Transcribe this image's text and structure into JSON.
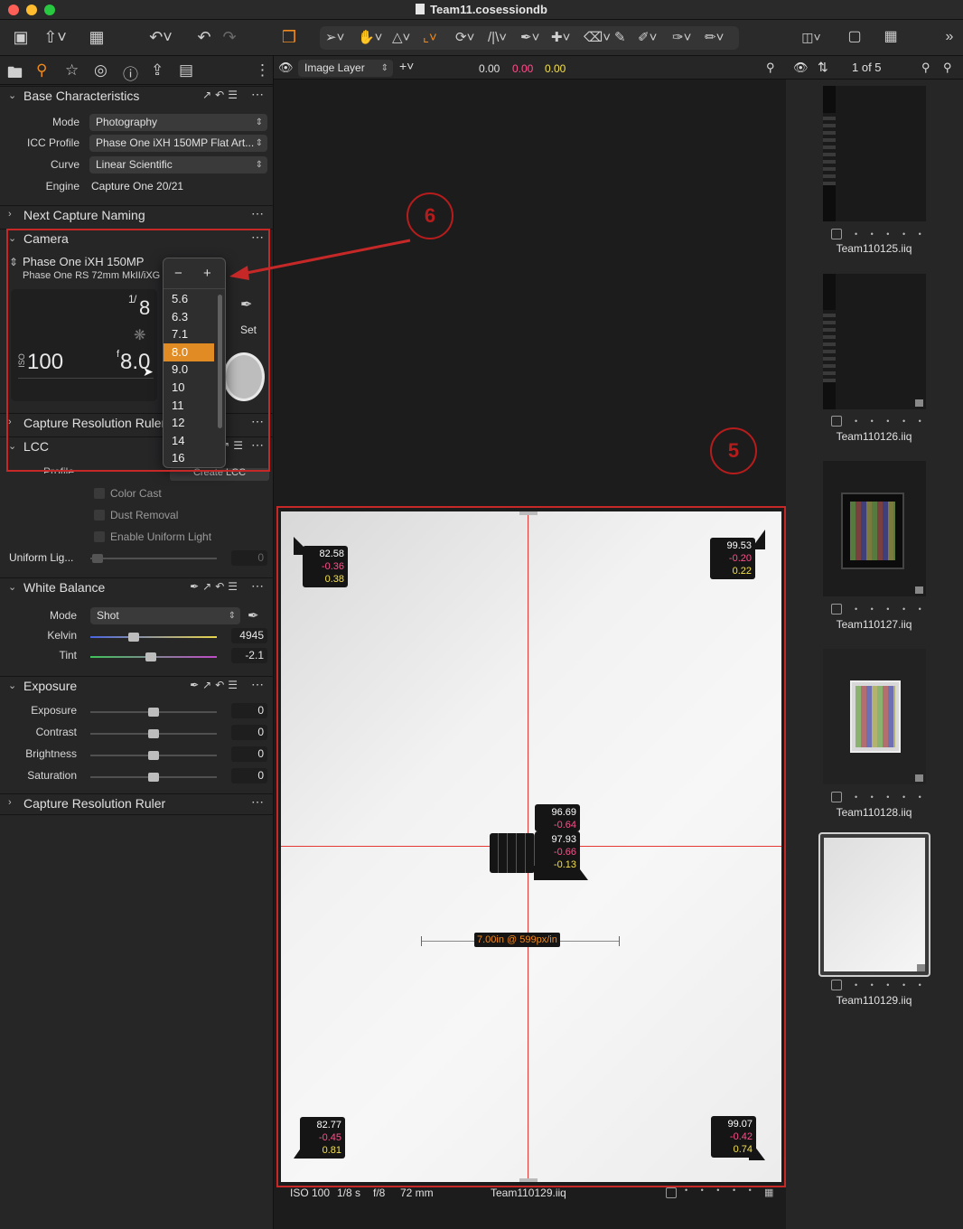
{
  "window": {
    "title": "Team11.cosessiondb"
  },
  "toolbar": {
    "icons": [
      "camera-icon",
      "export-icon",
      "edit-icon",
      "undo-history-icon",
      "undo-icon",
      "redo-icon",
      "variants-icon",
      "select-cursor-icon",
      "hand-pan-icon",
      "crop-straighten-icon",
      "crop-icon",
      "rotate-icon",
      "keystone-icon",
      "picker-icon",
      "heal-icon",
      "erase-icon",
      "brush-icon",
      "color-picker-icon",
      "annotation-icon",
      "gradient-icon"
    ],
    "right_icons": [
      "layout-icon",
      "proof-icon",
      "grid-icon",
      "more-icon"
    ]
  },
  "left_tabs": [
    "folder-icon",
    "adjust-icon",
    "star-icon",
    "color-icon",
    "info-icon",
    "export-icon",
    "list-icon"
  ],
  "base": {
    "title": "Base Characteristics",
    "mode_label": "Mode",
    "mode_value": "Photography",
    "icc_label": "ICC Profile",
    "icc_value": "Phase One iXH 150MP Flat Art...",
    "curve_label": "Curve",
    "curve_value": "Linear Scientific",
    "engine_label": "Engine",
    "engine_value": "Capture One 20/21"
  },
  "naming": {
    "title": "Next Capture Naming"
  },
  "camera": {
    "title": "Camera",
    "model": "Phase One iXH 150MP",
    "lens": "Phase One RS 72mm MkII/iXG",
    "shutter": "1/8",
    "shutter_num": "1",
    "shutter_den": "8",
    "iso_prefix": "ISO",
    "iso": "100",
    "aperture_prefix": "f",
    "aperture": "8.0",
    "set_label": "Set",
    "fstops": [
      "5.6",
      "6.3",
      "7.1",
      "8.0",
      "9.0",
      "10",
      "11",
      "12",
      "14",
      "16"
    ],
    "selected_fstop": "8.0",
    "minus": "−",
    "plus": "+"
  },
  "cap_res_1": {
    "title": "Capture Resolution Ruler"
  },
  "lcc": {
    "title": "LCC",
    "profile_label": "Profile",
    "create_label": "Create LCC",
    "color_cast": "Color Cast",
    "dust": "Dust Removal",
    "uniform": "Enable Uniform Light",
    "uniform_label": "Uniform Lig...",
    "uniform_value": "0"
  },
  "wb": {
    "title": "White Balance",
    "mode_label": "Mode",
    "mode_value": "Shot",
    "kelvin_label": "Kelvin",
    "kelvin_value": "4945",
    "tint_label": "Tint",
    "tint_value": "-2.1",
    "kelvin_pos": 0.34,
    "tint_pos": 0.48
  },
  "exposure": {
    "title": "Exposure",
    "rows": [
      {
        "label": "Exposure",
        "value": "0"
      },
      {
        "label": "Contrast",
        "value": "0"
      },
      {
        "label": "Brightness",
        "value": "0"
      },
      {
        "label": "Saturation",
        "value": "0"
      }
    ]
  },
  "cap_res_2": {
    "title": "Capture Resolution Ruler"
  },
  "viewer": {
    "layer": "Image Layer",
    "readout_l": "0.00",
    "readout_a": "0.00",
    "readout_b": "0.00",
    "probes": [
      {
        "l": "82.58",
        "a": "-0.36",
        "b": "0.38"
      },
      {
        "l": "99.53",
        "a": "-0.20",
        "b": "0.22"
      },
      {
        "l": "96.69",
        "a": "-0.64",
        "b": ""
      },
      {
        "l": "97.93",
        "a": "-0.66",
        "b": "-0.13"
      },
      {
        "l": "82.77",
        "a": "-0.45",
        "b": "0.81"
      },
      {
        "l": "99.07",
        "a": "-0.42",
        "b": "0.74"
      }
    ],
    "ruler": "7.00in @ 599px/in",
    "status_iso": "ISO 100",
    "status_shutter": "1/8 s",
    "status_aperture": "f/8",
    "status_focal": "72 mm",
    "status_file": "Team110129.iiq"
  },
  "browser": {
    "count": "1 of 5",
    "items": [
      {
        "name": "Team110125.iiq"
      },
      {
        "name": "Team110126.iiq"
      },
      {
        "name": "Team110127.iiq"
      },
      {
        "name": "Team110128.iiq"
      },
      {
        "name": "Team110129.iiq"
      }
    ],
    "dots": "• • • • •"
  },
  "annotations": {
    "five": "5",
    "six": "6"
  },
  "colors": {
    "accent": "#e08b24",
    "annotation": "#c62828",
    "a_channel": "#ff4f8b",
    "b_channel": "#f5e04a"
  }
}
